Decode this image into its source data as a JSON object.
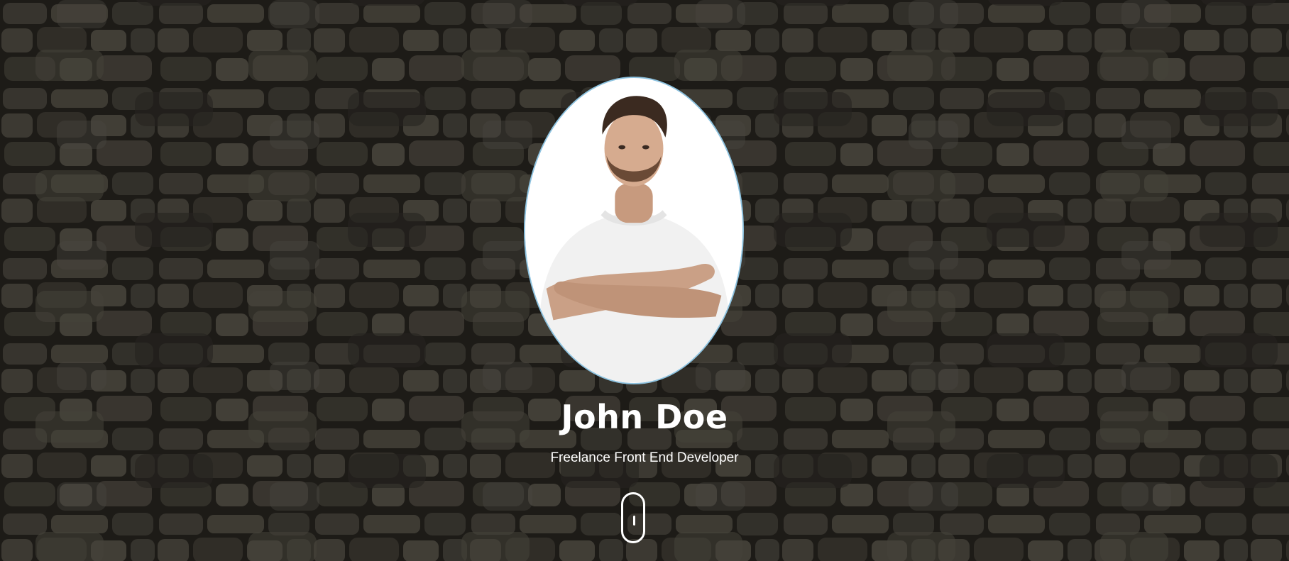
{
  "profile": {
    "name": "John Doe",
    "tagline": "Freelance Front End Developer"
  },
  "icons": {
    "scroll": "mouse-scroll-icon",
    "avatar": "profile-photo"
  },
  "colors": {
    "background": "#3a3832",
    "text": "#ffffff",
    "avatar_border": "#8ec3e0"
  }
}
